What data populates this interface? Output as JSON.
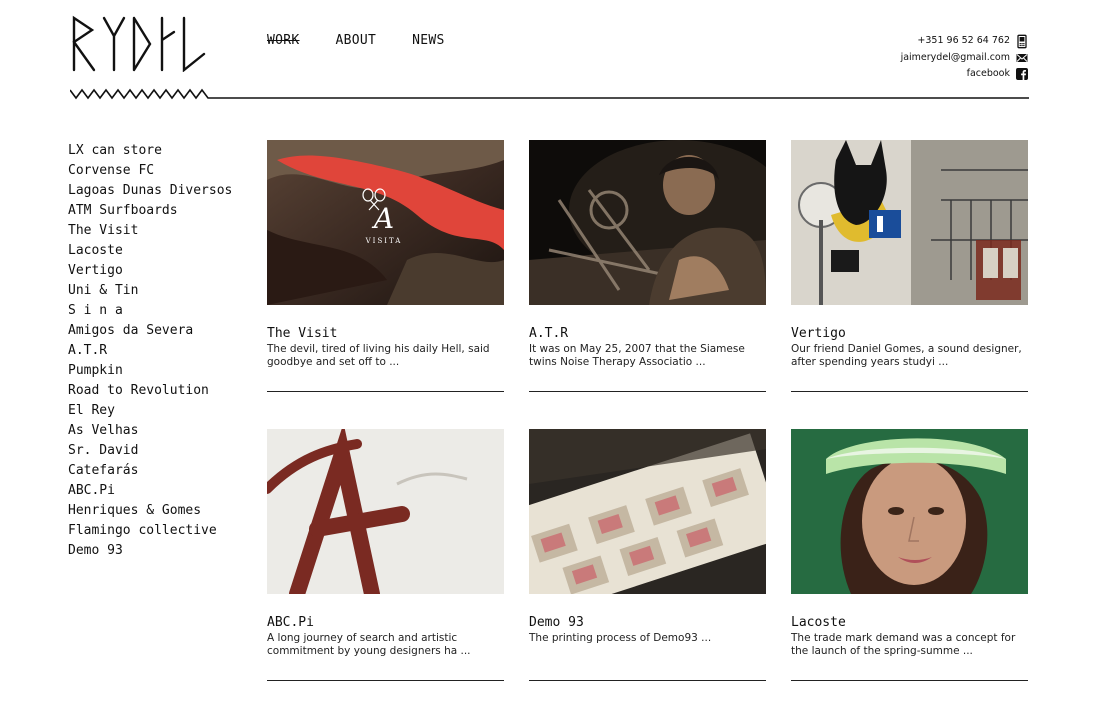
{
  "logo": {
    "alt": "RYDIL"
  },
  "nav": [
    {
      "label": "WORK",
      "active": true
    },
    {
      "label": "ABOUT",
      "active": false
    },
    {
      "label": "NEWS",
      "active": false
    }
  ],
  "contact": {
    "phone": "+351 96 52 64 762",
    "email": "jaimerydel@gmail.com",
    "social": "facebook"
  },
  "sidebar": {
    "items": [
      "LX can store",
      "Corvense FC",
      "Lagoas Dunas Diversos",
      "ATM Surfboards",
      "The Visit",
      "Lacoste",
      "Vertigo",
      "Uni & Tin",
      "S i n a",
      "Amigos da Severa",
      "A.T.R",
      "Pumpkin",
      "Road to Revolution",
      "El Rey",
      "As Velhas",
      "Sr. David",
      "Catefarás",
      "ABC.Pi",
      "Henriques & Gomes",
      "Flamingo collective",
      "Demo 93"
    ]
  },
  "projects": [
    {
      "title": "The Visit",
      "desc": "The devil, tired of living his daily Hell, said goodbye and set off to ...",
      "overlay": "VISITA"
    },
    {
      "title": "A.T.R",
      "desc": "It was on May 25, 2007 that the Siamese twins Noise Therapy Associatio ..."
    },
    {
      "title": "Vertigo",
      "desc": "Our friend Daniel Gomes, a sound designer, after spending years studyi ..."
    },
    {
      "title": "ABC.Pi",
      "desc": "A long journey of search and artistic commitment by young designers ha ..."
    },
    {
      "title": "Demo 93",
      "desc": "The printing process of Demo93 ..."
    },
    {
      "title": "Lacoste",
      "desc": "The trade mark demand was a concept for the launch of the spring-summe ..."
    }
  ]
}
